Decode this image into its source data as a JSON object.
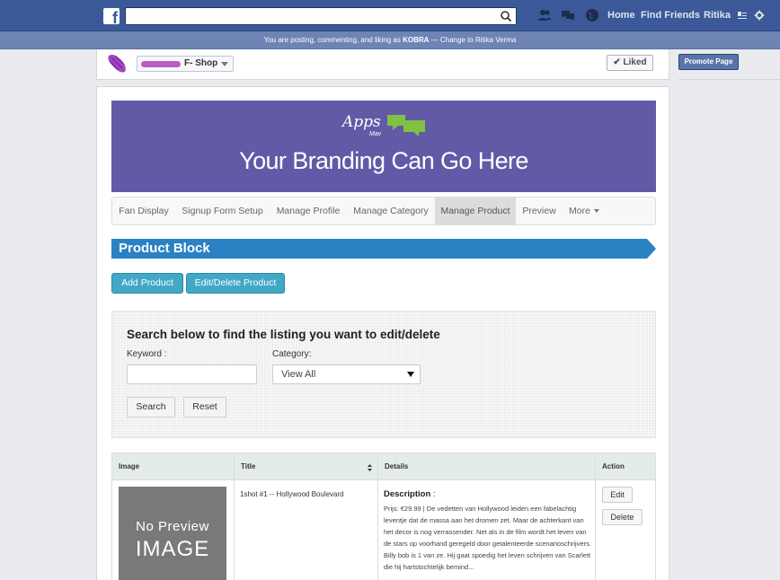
{
  "topbar": {
    "logo": "f",
    "nav_home": "Home",
    "nav_find_friends": "Find Friends",
    "nav_user": "Ritika"
  },
  "posting_bar": {
    "prefix": "You are posting, commenting, and liking as ",
    "page": "KOBRA",
    "suffix": " — Change to Ritika Verma"
  },
  "page_header": {
    "page_name": "F- Shop",
    "liked_label": "Liked",
    "promote_label": "Promote Page"
  },
  "banner": {
    "logo_text": "Apps",
    "logo_sub": "Mav",
    "tagline": "Your Branding Can Go Here",
    "bg_color": "#625aa6"
  },
  "tabs": [
    {
      "label": "Fan Display"
    },
    {
      "label": "Signup Form Setup"
    },
    {
      "label": "Manage Profile"
    },
    {
      "label": "Manage Category"
    },
    {
      "label": "Manage Product",
      "active": true
    },
    {
      "label": "Preview"
    },
    {
      "label": "More"
    }
  ],
  "block": {
    "title": "Product Block",
    "add_label": "Add Product",
    "edit_delete_label": "Edit/Delete Product"
  },
  "search": {
    "heading": "Search below to find the listing you want to edit/delete",
    "keyword_label": "Keyword :",
    "keyword_value": "",
    "category_label": "Category:",
    "category_value": "View All",
    "search_label": "Search",
    "reset_label": "Reset"
  },
  "table": {
    "headers": [
      "Image",
      "Title",
      "Details",
      "Action"
    ],
    "rows": [
      {
        "image_l1": "No Preview",
        "image_l2": "IMAGE",
        "title": "1shot #1 -- Hollywood Boulevard",
        "desc_label": "Description",
        "desc_colon": " :",
        "details": "Prijs: €29.99 | De vedetten van Hollywood leiden een fabelachtig leventje dat de massa aan het dromen zet. Maar de achterkant van het decor is nog verrassender. Net als in de film wordt het leven van de stars op voorhand geregeld door getalenteerde scenarioschrijvers. Billy bob is 1 van ze. Hij gaat spoedig het leven schrijven van Scarlett die hij hartstochtelijk bemind...",
        "edit_label": "Edit",
        "delete_label": "Delete"
      }
    ]
  }
}
